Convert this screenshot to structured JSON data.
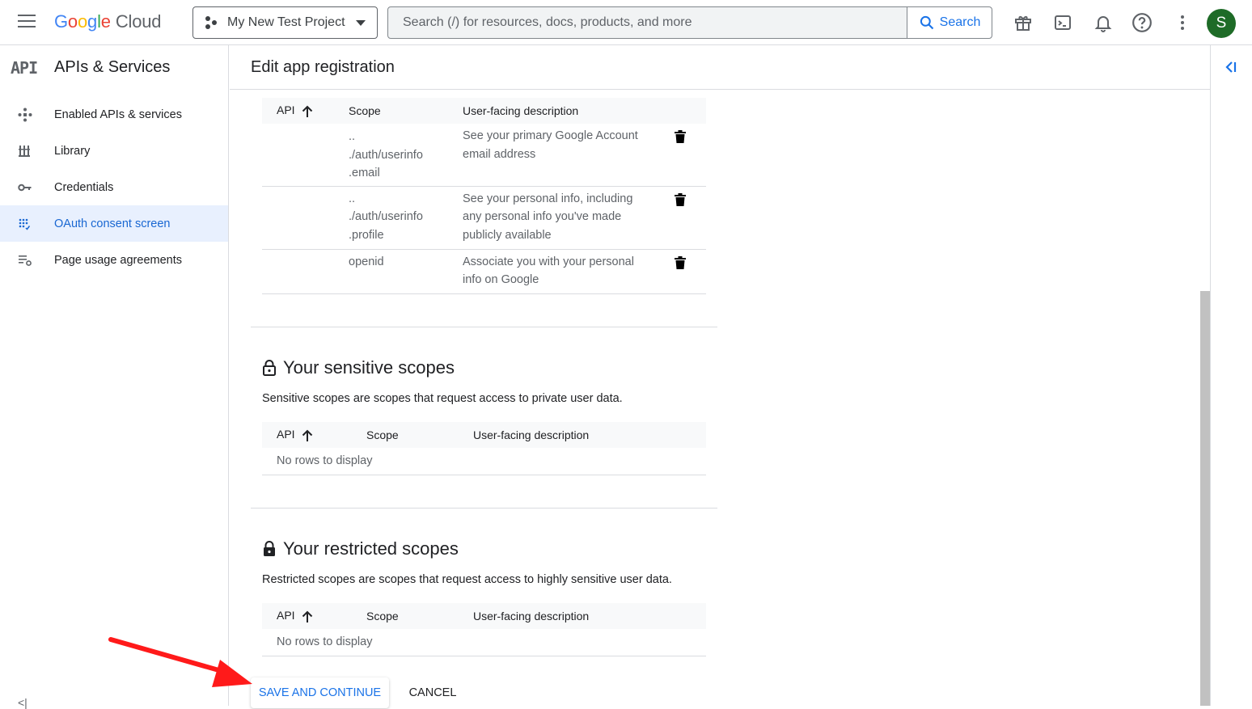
{
  "header": {
    "logo_google": [
      "G",
      "o",
      "o",
      "g",
      "l",
      "e"
    ],
    "logo_cloud": "Cloud",
    "project_name": "My New Test Project",
    "search_placeholder": "Search (/) for resources, docs, products, and more",
    "search_button": "Search",
    "avatar_initial": "S",
    "avatar_color": "#1e6b27"
  },
  "sidebar": {
    "logo": "API",
    "title": "APIs & Services",
    "items": [
      {
        "label": "Enabled APIs & services",
        "icon": "api-hub-icon"
      },
      {
        "label": "Library",
        "icon": "library-icon"
      },
      {
        "label": "Credentials",
        "icon": "key-icon"
      },
      {
        "label": "OAuth consent screen",
        "icon": "consent-grid-icon",
        "active": true
      },
      {
        "label": "Page usage agreements",
        "icon": "settings-list-icon"
      }
    ],
    "collapse_glyph": "<|"
  },
  "main": {
    "title": "Edit app registration",
    "non_sensitive_table": {
      "columns": [
        "API",
        "Scope",
        "User-facing description"
      ],
      "rows": [
        {
          "scope": [
            "..",
            "./auth/userinfo",
            ".email"
          ],
          "description": [
            "See your primary Google Account",
            "email address"
          ]
        },
        {
          "scope": [
            "..",
            "./auth/userinfo",
            ".profile"
          ],
          "description": [
            "See your personal info, including",
            "any personal info you've made",
            "publicly available"
          ]
        },
        {
          "scope": [
            "openid"
          ],
          "description": [
            "Associate you with your personal",
            "info on Google"
          ]
        }
      ]
    },
    "sensitive": {
      "title": "Your sensitive scopes",
      "description": "Sensitive scopes are scopes that request access to private user data.",
      "columns": [
        "API",
        "Scope",
        "User-facing description"
      ],
      "empty_text": "No rows to display"
    },
    "restricted": {
      "title": "Your restricted scopes",
      "description": "Restricted scopes are scopes that request access to highly sensitive user data.",
      "columns": [
        "API",
        "Scope",
        "User-facing description"
      ],
      "empty_text": "No rows to display"
    },
    "save_button": "SAVE AND CONTINUE",
    "cancel_button": "CANCEL"
  },
  "colors": {
    "accent": "#1a73e8",
    "active_bg": "#e8f0fe",
    "annotation_arrow": "#ff1a1a"
  }
}
